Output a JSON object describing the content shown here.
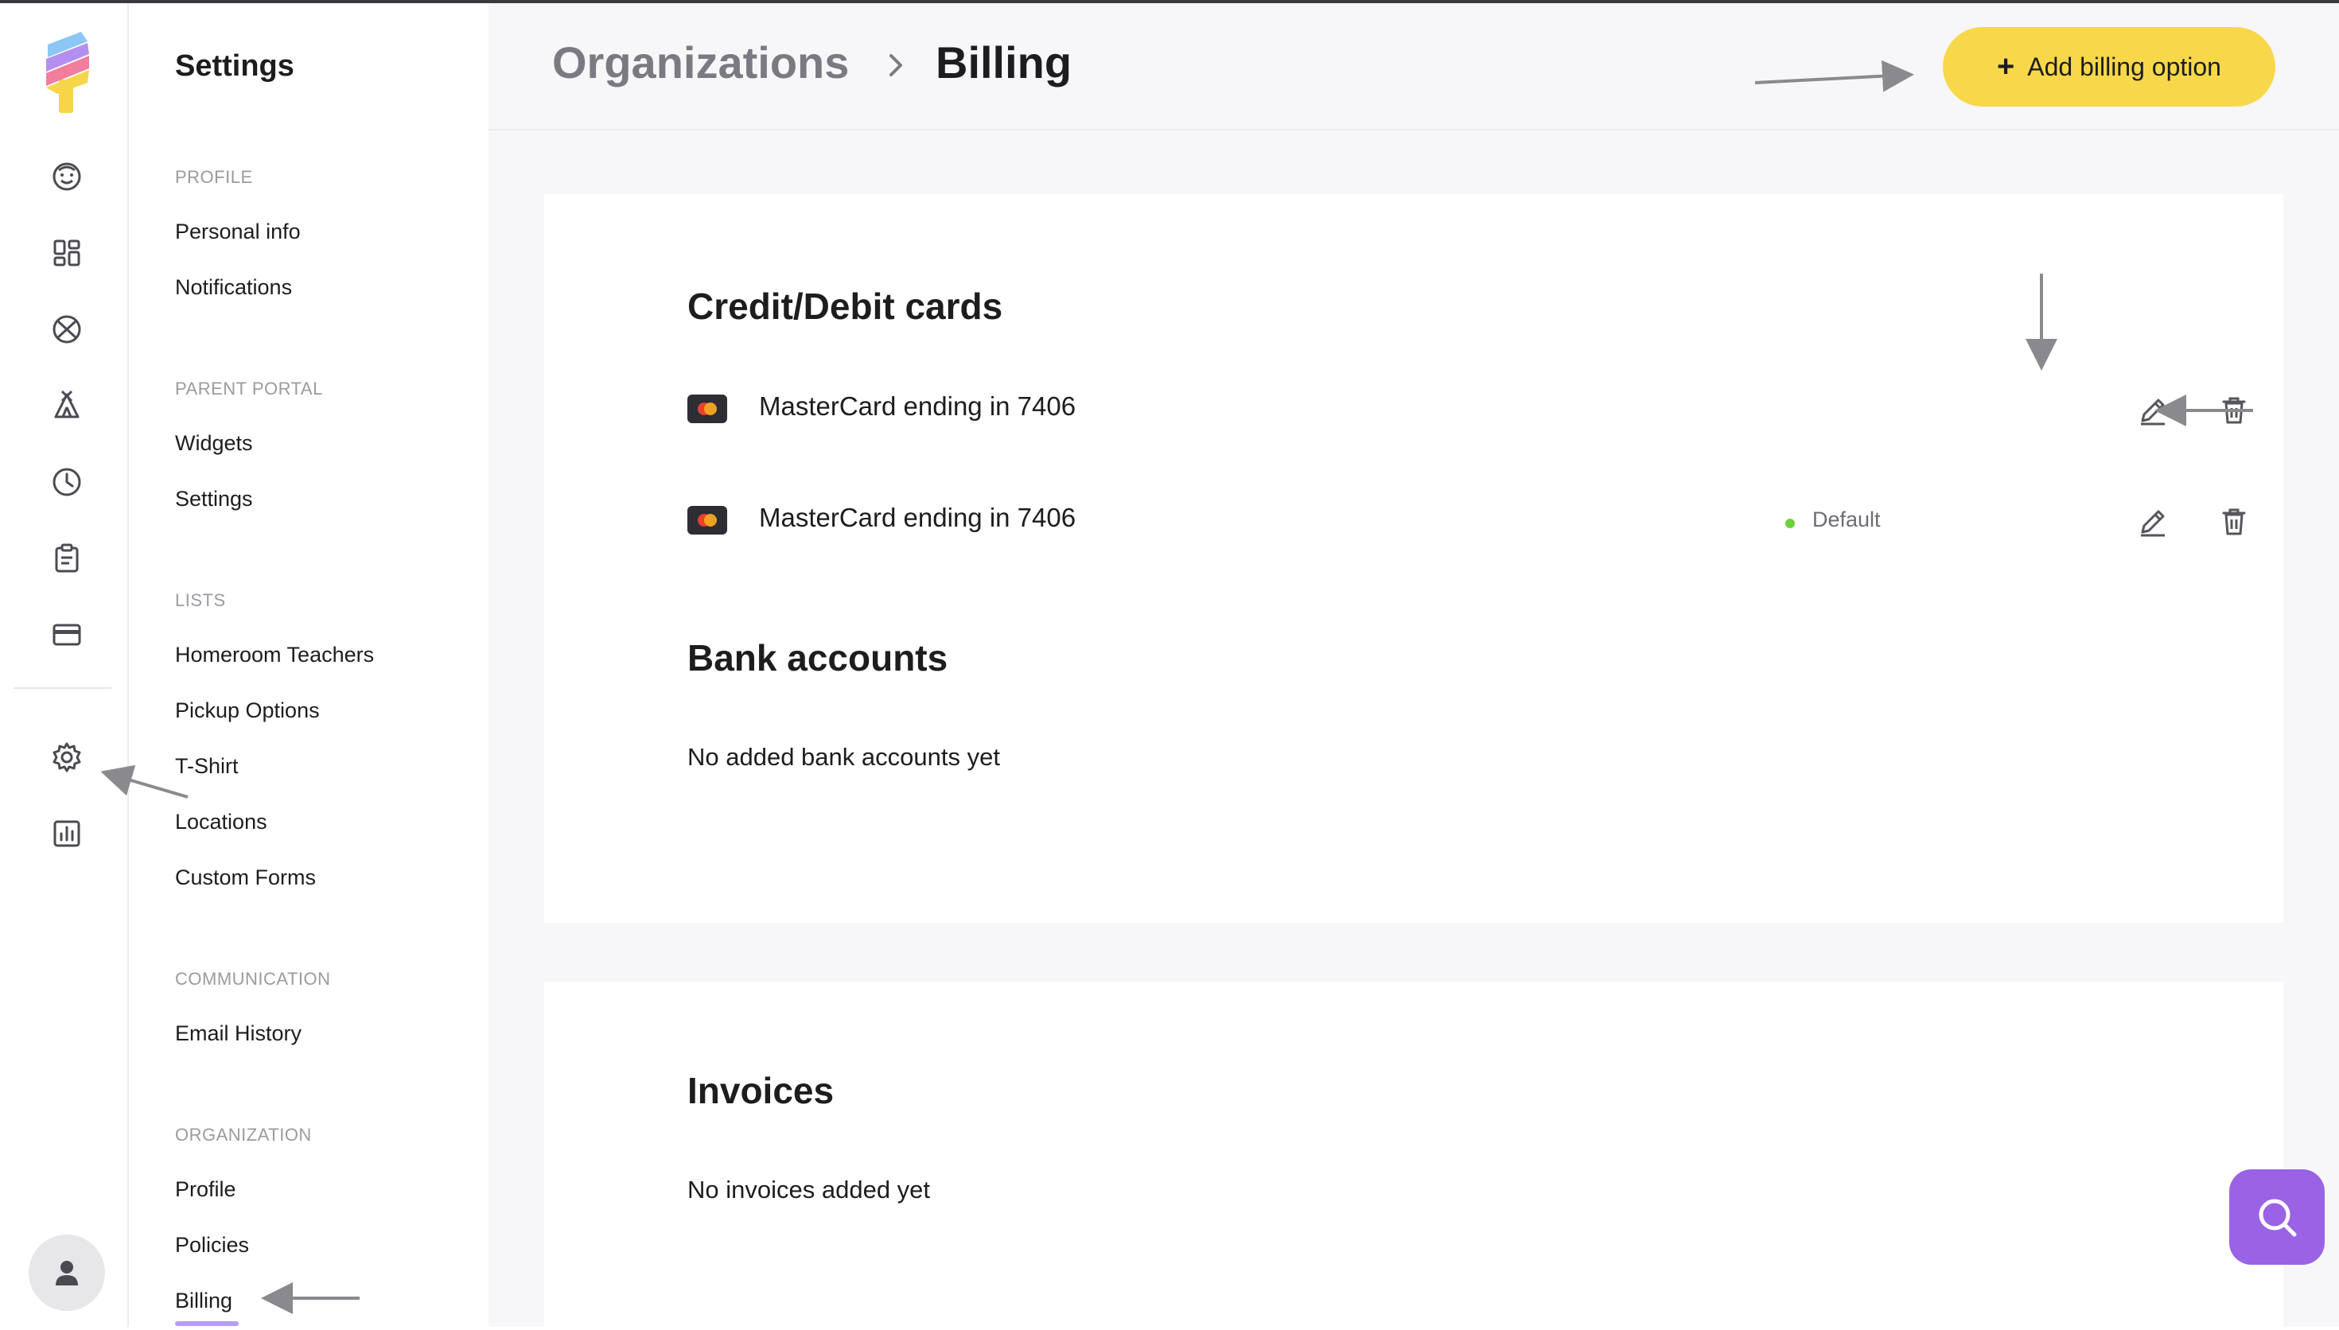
{
  "sidebar": {
    "title": "Settings",
    "sections": [
      {
        "label": "PROFILE",
        "items": [
          "Personal info",
          "Notifications"
        ]
      },
      {
        "label": "PARENT PORTAL",
        "items": [
          "Widgets",
          "Settings"
        ]
      },
      {
        "label": "LISTS",
        "items": [
          "Homeroom Teachers",
          "Pickup Options",
          "T-Shirt",
          "Locations",
          "Custom Forms"
        ]
      },
      {
        "label": "COMMUNICATION",
        "items": [
          "Email History"
        ]
      },
      {
        "label": "ORGANIZATION",
        "items": [
          "Profile",
          "Policies",
          "Billing"
        ]
      }
    ],
    "active_item": "Billing"
  },
  "rail": {
    "icons": [
      "smiley-icon",
      "dashboard-icon",
      "sports-ball-icon",
      "tent-icon",
      "clock-icon",
      "clipboard-icon",
      "credit-card-icon",
      "gear-icon",
      "chart-icon"
    ],
    "active_icon": "gear-icon"
  },
  "header": {
    "breadcrumb_parent": "Organizations",
    "breadcrumb_current": "Billing",
    "add_button_label": "Add billing option",
    "add_button_color": "#f8d84a"
  },
  "billing": {
    "cards_heading": "Credit/Debit cards",
    "cards": [
      {
        "label": "MasterCard ending in 7406",
        "default": false
      },
      {
        "label": "MasterCard ending in 7406",
        "default": true,
        "default_label": "Default"
      }
    ],
    "bank_heading": "Bank accounts",
    "bank_empty": "No added bank accounts yet"
  },
  "invoices": {
    "heading": "Invoices",
    "empty": "No invoices added yet"
  },
  "colors": {
    "accent_purple": "#9a63e6",
    "default_green": "#6fcf3f",
    "annotation_arrow": "#8a8a8e"
  }
}
